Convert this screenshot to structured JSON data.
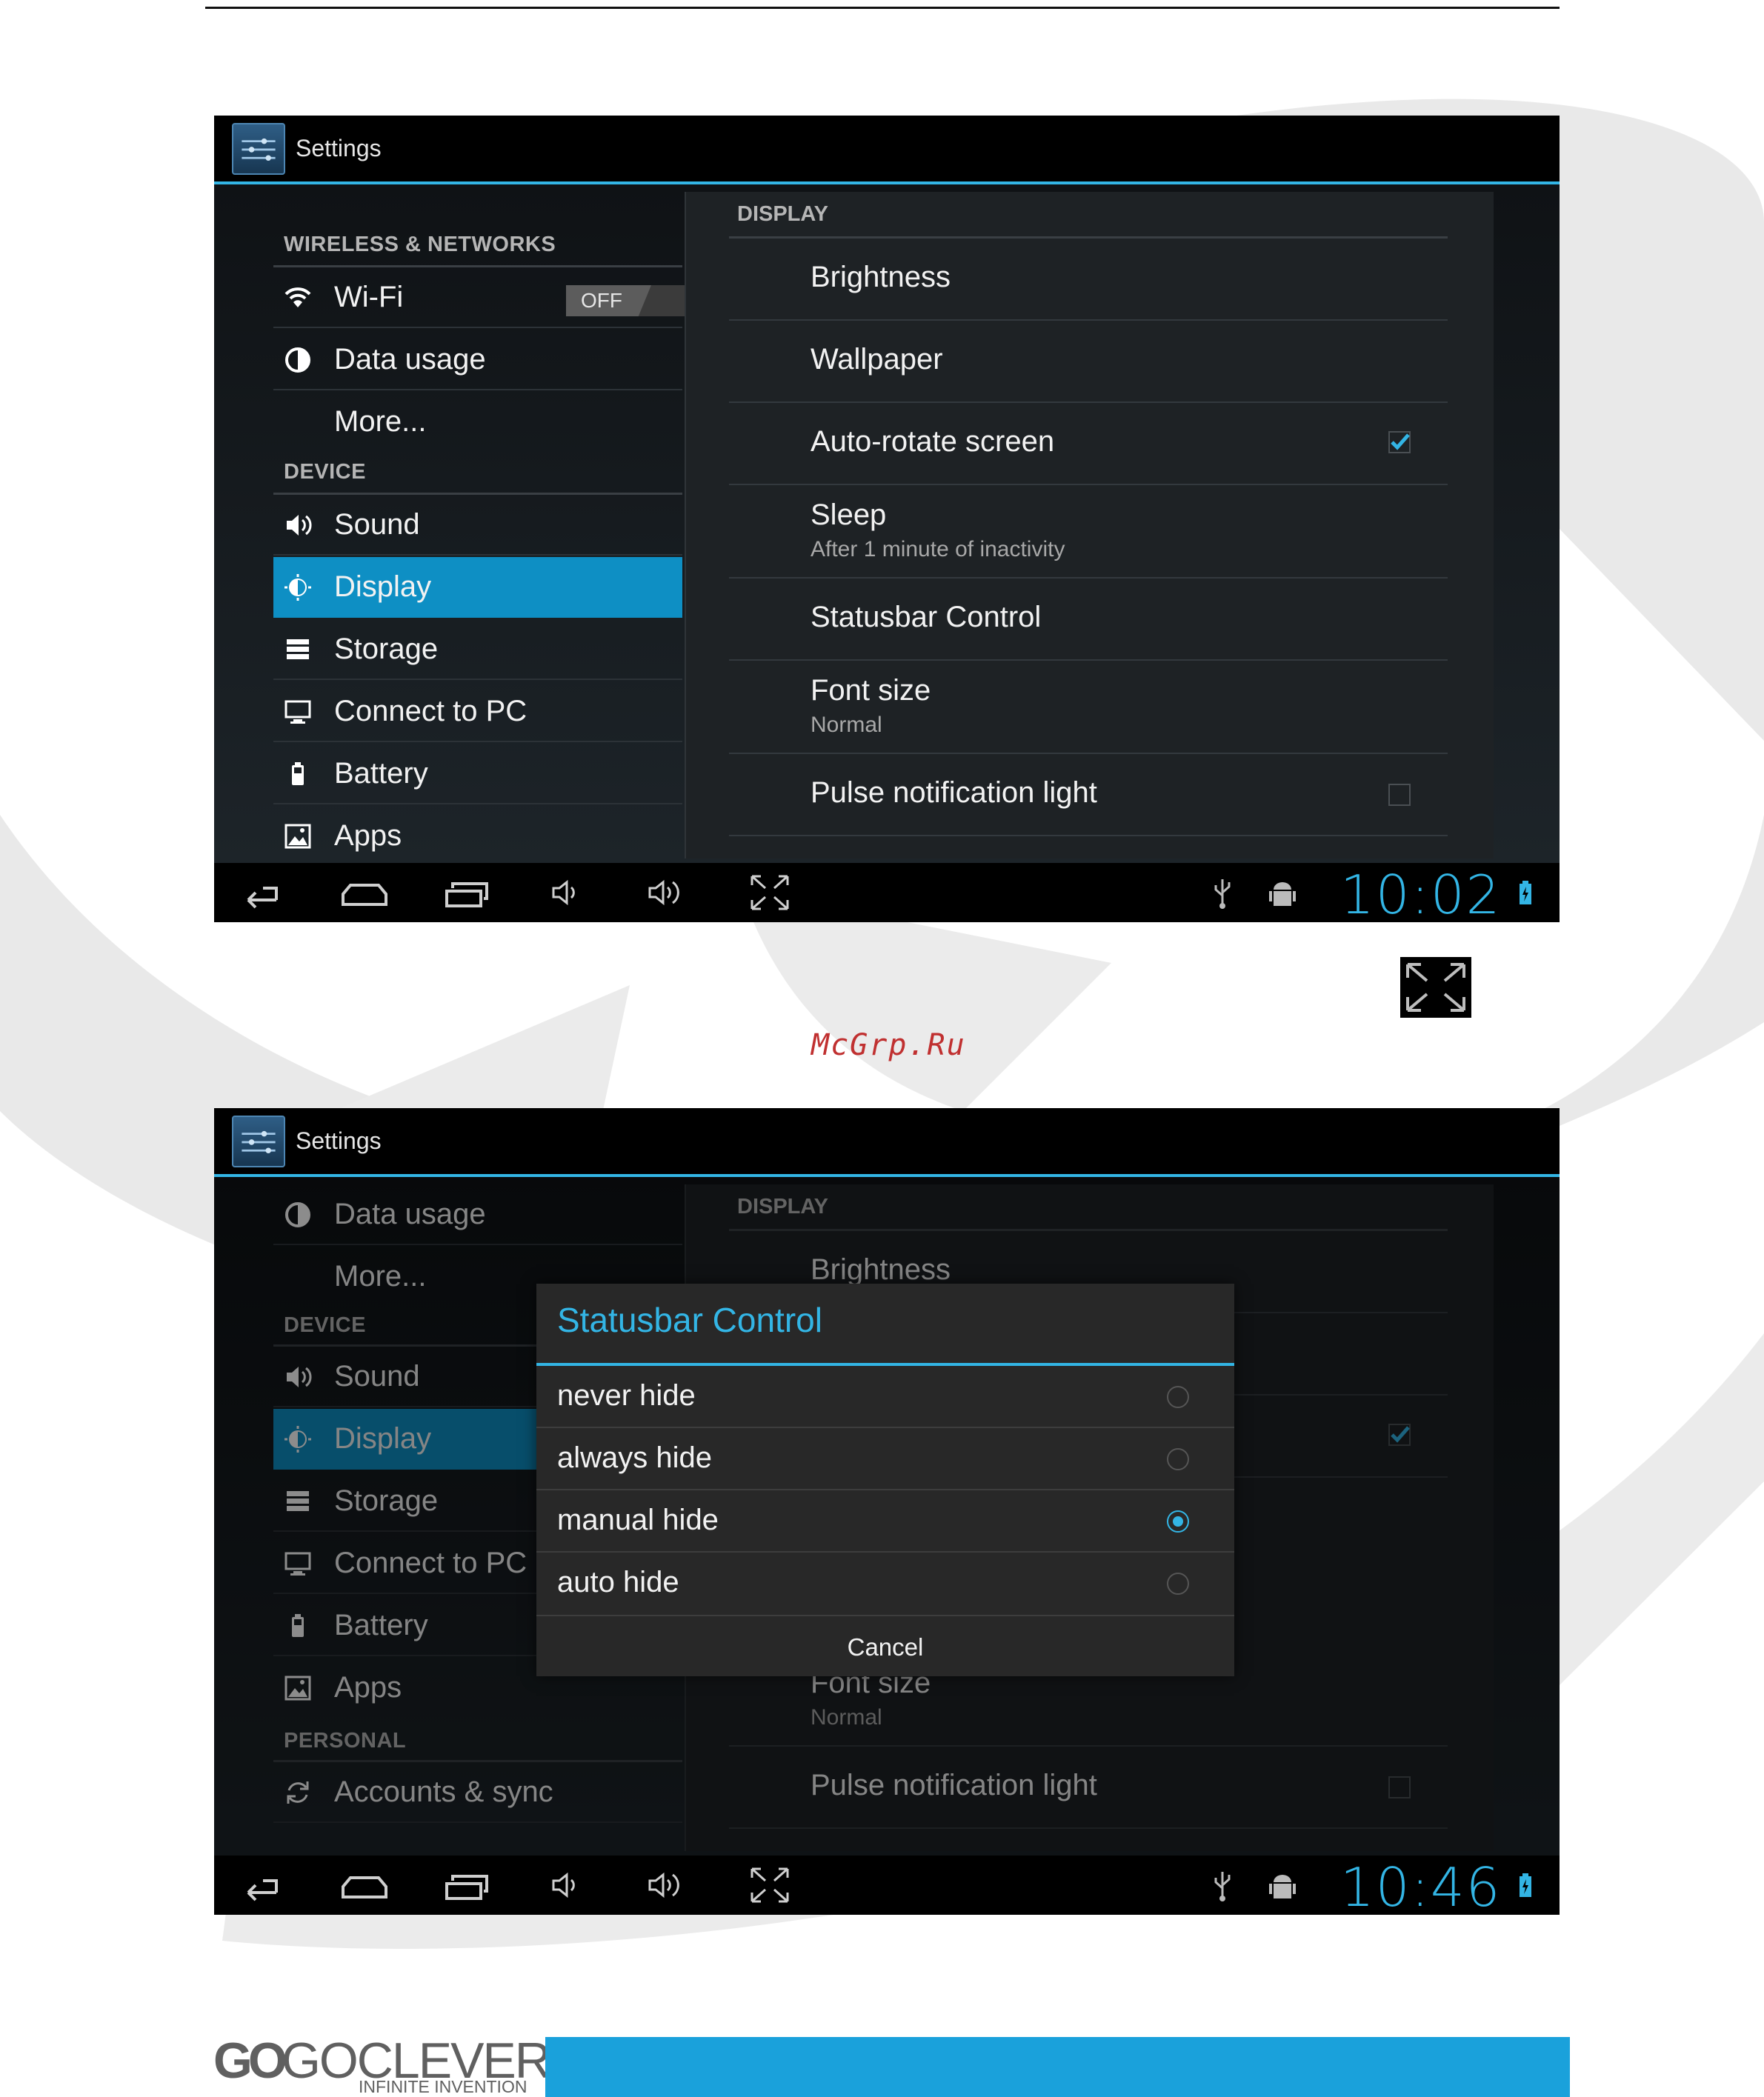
{
  "colors": {
    "accent": "#33b5e5",
    "selected": "#0e8fc4",
    "brand_band": "#1aa1db",
    "watermark": "#c03030"
  },
  "screen1": {
    "title": "Settings",
    "sidebar": {
      "header_wireless": "WIRELESS & NETWORKS",
      "wifi": "Wi-Fi",
      "wifi_toggle": "OFF",
      "data_usage": "Data usage",
      "more": "More...",
      "header_device": "DEVICE",
      "sound": "Sound",
      "display": "Display",
      "storage": "Storage",
      "connect_pc": "Connect to PC",
      "battery": "Battery",
      "apps": "Apps"
    },
    "main": {
      "section": "DISPLAY",
      "brightness": "Brightness",
      "wallpaper": "Wallpaper",
      "auto_rotate": "Auto-rotate screen",
      "auto_rotate_checked": true,
      "sleep": "Sleep",
      "sleep_summary": "After 1 minute of inactivity",
      "statusbar": "Statusbar Control",
      "font_size": "Font size",
      "font_size_summary": "Normal",
      "pulse": "Pulse notification light",
      "pulse_checked": false
    },
    "clock": "10:02"
  },
  "watermark": "McGrp.Ru",
  "screen2": {
    "title": "Settings",
    "sidebar": {
      "data_usage": "Data usage",
      "more": "More...",
      "header_device": "DEVICE",
      "sound": "Sound",
      "display": "Display",
      "storage": "Storage",
      "connect_pc": "Connect to PC",
      "battery": "Battery",
      "apps": "Apps",
      "header_personal": "PERSONAL",
      "accounts": "Accounts & sync"
    },
    "main": {
      "section": "DISPLAY",
      "brightness": "Brightness",
      "font_size": "Font size",
      "font_size_summary": "Normal",
      "pulse": "Pulse notification light"
    },
    "dialog": {
      "title": "Statusbar Control",
      "options": [
        "never hide",
        "always hide",
        "manual hide",
        "auto hide"
      ],
      "selected": "manual hide",
      "cancel": "Cancel"
    },
    "clock": "10:46"
  },
  "footer": {
    "brand_go": "GO",
    "brand_clever": "GOCLEVER",
    "tagline": "INFINITE INVENTION"
  }
}
